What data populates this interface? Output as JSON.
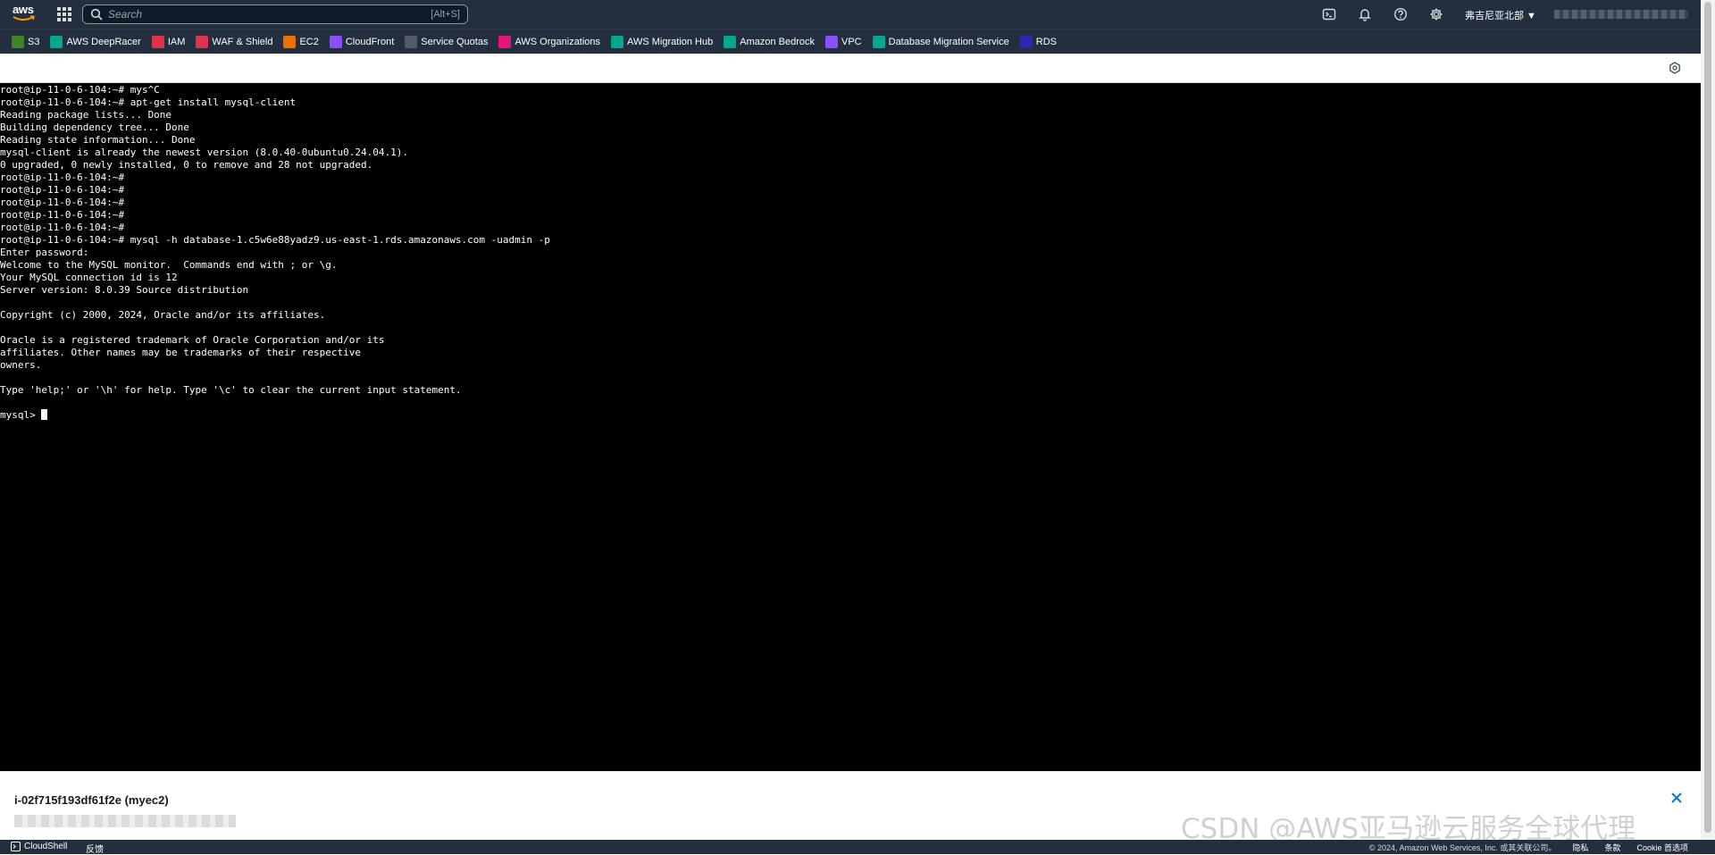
{
  "nav": {
    "logo_text": "aws",
    "search_placeholder": "Search",
    "search_shortcut": "[Alt+S]",
    "region": "弗吉尼亚北部 ▼"
  },
  "favorites": [
    {
      "label": "S3",
      "color": "#3f8624",
      "icon": "s3-icon"
    },
    {
      "label": "AWS DeepRacer",
      "color": "#01a88d",
      "icon": "deepracer-icon"
    },
    {
      "label": "IAM",
      "color": "#dd344c",
      "icon": "iam-icon"
    },
    {
      "label": "WAF & Shield",
      "color": "#dd344c",
      "icon": "waf-icon"
    },
    {
      "label": "EC2",
      "color": "#ed7100",
      "icon": "ec2-icon"
    },
    {
      "label": "CloudFront",
      "color": "#8c4fff",
      "icon": "cloudfront-icon"
    },
    {
      "label": "Service Quotas",
      "color": "#545b64",
      "icon": "service-quotas-icon"
    },
    {
      "label": "AWS Organizations",
      "color": "#e7157b",
      "icon": "organizations-icon"
    },
    {
      "label": "AWS Migration Hub",
      "color": "#01a88d",
      "icon": "migration-hub-icon"
    },
    {
      "label": "Amazon Bedrock",
      "color": "#01a88d",
      "icon": "bedrock-icon"
    },
    {
      "label": "VPC",
      "color": "#8c4fff",
      "icon": "vpc-icon"
    },
    {
      "label": "Database Migration Service",
      "color": "#01a88d",
      "icon": "dms-icon"
    },
    {
      "label": "RDS",
      "color": "#2e27ad",
      "icon": "rds-icon"
    }
  ],
  "terminal": {
    "lines": [
      "root@ip-11-0-6-104:~# mys^C",
      "root@ip-11-0-6-104:~# apt-get install mysql-client",
      "Reading package lists... Done",
      "Building dependency tree... Done",
      "Reading state information... Done",
      "mysql-client is already the newest version (8.0.40-0ubuntu0.24.04.1).",
      "0 upgraded, 0 newly installed, 0 to remove and 28 not upgraded.",
      "root@ip-11-0-6-104:~#",
      "root@ip-11-0-6-104:~#",
      "root@ip-11-0-6-104:~#",
      "root@ip-11-0-6-104:~#",
      "root@ip-11-0-6-104:~#",
      "root@ip-11-0-6-104:~# mysql -h database-1.c5w6e88yadz9.us-east-1.rds.amazonaws.com -uadmin -p",
      "Enter password:",
      "Welcome to the MySQL monitor.  Commands end with ; or \\g.",
      "Your MySQL connection id is 12",
      "Server version: 8.0.39 Source distribution",
      "",
      "Copyright (c) 2000, 2024, Oracle and/or its affiliates.",
      "",
      "Oracle is a registered trademark of Oracle Corporation and/or its",
      "affiliates. Other names may be trademarks of their respective",
      "owners.",
      "",
      "Type 'help;' or '\\h' for help. Type '\\c' to clear the current input statement.",
      ""
    ],
    "prompt": "mysql> "
  },
  "instance": {
    "title": "i-02f715f193df61f2e (myec2)"
  },
  "watermark": "CSDN @AWS亚马逊云服务全球代理",
  "footer": {
    "cloudshell": "CloudShell",
    "feedback": "反馈",
    "copyright": "© 2024, Amazon Web Services, Inc. 或其关联公司。",
    "privacy": "隐私",
    "terms": "条款",
    "cookie": "Cookie 首选项"
  }
}
